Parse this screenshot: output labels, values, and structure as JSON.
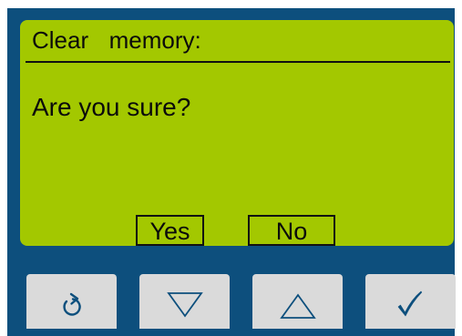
{
  "screen": {
    "title": "Clear  memory:",
    "prompt": "Are you sure?",
    "yes_label": "Yes",
    "no_label": "No"
  },
  "keypad": {
    "buttons": [
      {
        "action": "back",
        "icon": "refresh-icon"
      },
      {
        "action": "down",
        "icon": "down-triangle-icon"
      },
      {
        "action": "up",
        "icon": "up-triangle-icon"
      },
      {
        "action": "confirm",
        "icon": "checkmark-icon"
      }
    ]
  },
  "colors": {
    "bezel": "#0d4f7d",
    "display_background": "#a3c800",
    "display_text": "#0b0b0b",
    "key_face": "#dadada",
    "key_symbol": "#0d4f7d"
  }
}
